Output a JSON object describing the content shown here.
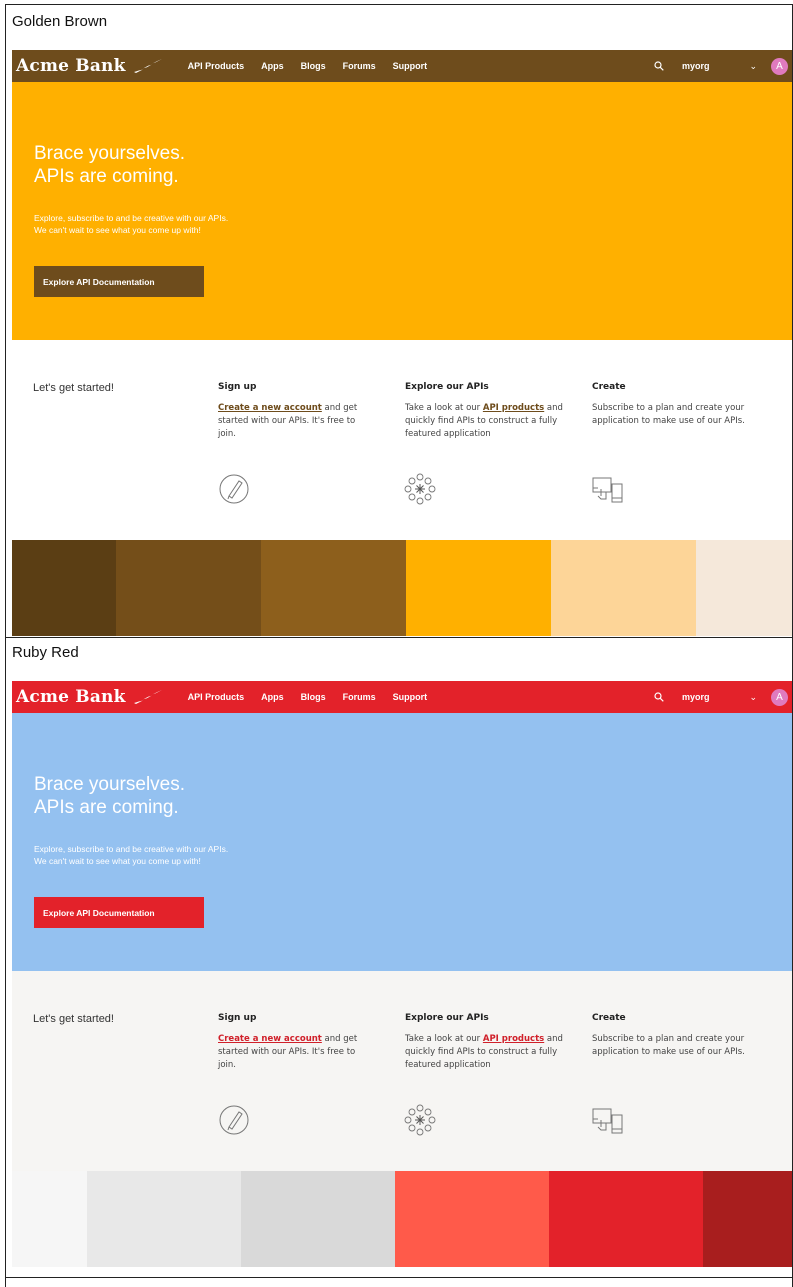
{
  "themes": [
    {
      "caption": "Golden Brown",
      "nav_bg": "#6e4c1c",
      "hero_bg": "#ffb000",
      "button_bg": "#6e4c1c",
      "link_color": "#6e4c1c",
      "section_bg": "#ffffff",
      "swatches": [
        "#5b3e14",
        "#744e19",
        "#8d5f1c",
        "#ffb000",
        "#fdd598",
        "#f5e8da"
      ]
    },
    {
      "caption": "Ruby Red",
      "nav_bg": "#e3222a",
      "hero_bg": "#94c1f0",
      "button_bg": "#e3222a",
      "link_color": "#d0202a",
      "section_bg": "#f6f5f3",
      "swatches": [
        "#f6f6f6",
        "#e8e8e8",
        "#d9d9d9",
        "#ff5a4a",
        "#e3222a",
        "#a81e1e"
      ]
    }
  ],
  "site": {
    "logo": "Acme Bank",
    "nav_items": [
      "API Products",
      "Apps",
      "Blogs",
      "Forums",
      "Support"
    ],
    "org": "myorg",
    "avatar_initial": "A",
    "search_icon": "search-icon",
    "chevron_icon": "chevron-down-icon"
  },
  "hero": {
    "title_line1": "Brace yourselves.",
    "title_line2": "APIs are coming.",
    "text_line1": "Explore, subscribe to and be creative with our APIs.",
    "text_line2": "We can't wait to see what you come up with!",
    "button": "Explore API Documentation"
  },
  "getting_started": {
    "title": "Let's get started!",
    "signup": {
      "heading": "Sign up",
      "link": "Create a new account",
      "text": " and get started with our APIs. It's free to join.",
      "icon": "pencil-icon"
    },
    "explore": {
      "heading": "Explore our APIs",
      "text_before": "Take a look at our ",
      "link": "API products",
      "text_after": " and quickly find APIs to construct a fully featured application",
      "icon": "network-icon"
    },
    "create": {
      "heading": "Create",
      "text": "Subscribe to a plan and create your application to make use of our APIs.",
      "icon": "app-touch-icon"
    }
  }
}
